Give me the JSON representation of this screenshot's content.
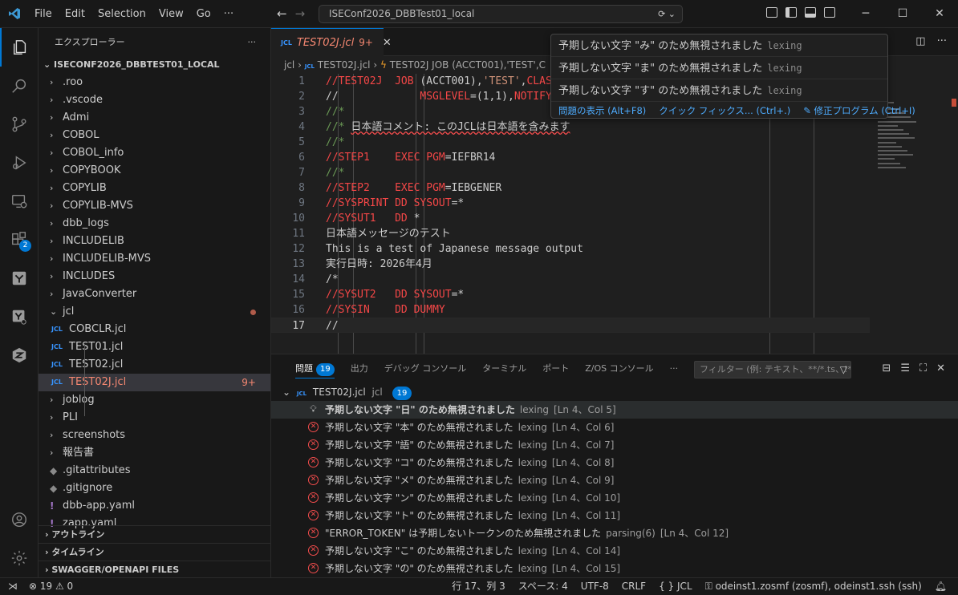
{
  "titlebar": {
    "menu": [
      "File",
      "Edit",
      "Selection",
      "View",
      "Go",
      "···"
    ],
    "search": "ISEConf2026_DBBTest01_local"
  },
  "activity": {
    "extensions_badge": "2"
  },
  "sidebar": {
    "title": "エクスプローラー",
    "more": "···",
    "root": "ISECONF2026_DBBTEST01_LOCAL",
    "items": [
      {
        "label": ".roo",
        "type": "folder"
      },
      {
        "label": ".vscode",
        "type": "folder"
      },
      {
        "label": "Admi",
        "type": "folder"
      },
      {
        "label": "COBOL",
        "type": "folder"
      },
      {
        "label": "COBOL_info",
        "type": "folder"
      },
      {
        "label": "COPYBOOK",
        "type": "folder"
      },
      {
        "label": "COPYLIB",
        "type": "folder"
      },
      {
        "label": "COPYLIB-MVS",
        "type": "folder"
      },
      {
        "label": "dbb_logs",
        "type": "folder"
      },
      {
        "label": "INCLUDELIB",
        "type": "folder"
      },
      {
        "label": "INCLUDELIB-MVS",
        "type": "folder"
      },
      {
        "label": "INCLUDES",
        "type": "folder"
      },
      {
        "label": "JavaConverter",
        "type": "folder"
      },
      {
        "label": "jcl",
        "type": "folder-open"
      },
      {
        "label": "COBCLR.jcl",
        "type": "jcl"
      },
      {
        "label": "TEST01.jcl",
        "type": "jcl"
      },
      {
        "label": "TEST02.jcl",
        "type": "jcl"
      },
      {
        "label": "TEST02J.jcl",
        "type": "jcl",
        "decoration": "9+"
      },
      {
        "label": "joblog",
        "type": "folder"
      },
      {
        "label": "PLI",
        "type": "folder"
      },
      {
        "label": "screenshots",
        "type": "folder"
      },
      {
        "label": "報告書",
        "type": "folder"
      },
      {
        "label": ".gitattributes",
        "type": "git"
      },
      {
        "label": ".gitignore",
        "type": "git"
      },
      {
        "label": "dbb-app.yaml",
        "type": "yaml"
      },
      {
        "label": "zapp.yaml",
        "type": "yaml"
      }
    ],
    "sections": [
      "アウトライン",
      "タイムライン",
      "SWAGGER/OPENAPI FILES"
    ]
  },
  "editor": {
    "tab": {
      "icon": "JCL",
      "name": "TEST02J.jcl",
      "count": "9+"
    },
    "breadcrumb": {
      "folder": "jcl",
      "file": "TEST02J.jcl",
      "symbol": "TEST02J  JOB (ACCT001),'TEST',C"
    },
    "lines": [
      {
        "n": "1",
        "t": "//TEST02J  JOB (ACCT001),'TEST',CLASS"
      },
      {
        "n": "2",
        "t": "//             MSGLEVEL=(1,1),NOTIFY"
      },
      {
        "n": "3",
        "t": "//*"
      },
      {
        "n": "4",
        "t": "//* 日本語コメント: このJCLは日本語を含みます"
      },
      {
        "n": "5",
        "t": "//*"
      },
      {
        "n": "6",
        "t": "//STEP1    EXEC PGM=IEFBR14"
      },
      {
        "n": "7",
        "t": "//*"
      },
      {
        "n": "8",
        "t": "//STEP2    EXEC PGM=IEBGENER"
      },
      {
        "n": "9",
        "t": "//SYSPRINT DD SYSOUT=*"
      },
      {
        "n": "10",
        "t": "//SYSUT1   DD *"
      },
      {
        "n": "11",
        "t": "日本語メッセージのテスト"
      },
      {
        "n": "12",
        "t": "This is a test of Japanese message output"
      },
      {
        "n": "13",
        "t": "実行日時: 2026年4月"
      },
      {
        "n": "14",
        "t": "/*"
      },
      {
        "n": "15",
        "t": "//SYSUT2   DD SYSOUT=*"
      },
      {
        "n": "16",
        "t": "//SYSIN    DD DUMMY"
      },
      {
        "n": "17",
        "t": "//"
      }
    ]
  },
  "hover": {
    "messages": [
      {
        "text": "予期しない文字 \"み\" のため無視されました",
        "source": "lexing"
      },
      {
        "text": "予期しない文字 \"ま\" のため無視されました",
        "source": "lexing"
      },
      {
        "text": "予期しない文字 \"す\" のため無視されました",
        "source": "lexing"
      }
    ],
    "actions": [
      "問題の表示 (Alt+F8)",
      "クイック フィックス... (Ctrl+.)",
      "修正プログラム (Ctrl+I)"
    ]
  },
  "panel": {
    "tabs": [
      {
        "label": "問題",
        "badge": "19"
      },
      {
        "label": "出力"
      },
      {
        "label": "デバッグ コンソール"
      },
      {
        "label": "ターミナル"
      },
      {
        "label": "ポート"
      },
      {
        "label": "Z/OS コンソール"
      },
      {
        "label": "···"
      }
    ],
    "filter_placeholder": "フィルター (例: テキスト、**/*.ts、!*...",
    "file": {
      "icon": "JCL",
      "name": "TEST02J.jcl",
      "dir": "jcl",
      "count": "19"
    },
    "problems": [
      {
        "msg": "予期しない文字 \"日\" のため無視されました",
        "src": "lexing",
        "loc": "[Ln 4、Col 5]",
        "kind": "bulb"
      },
      {
        "msg": "予期しない文字 \"本\" のため無視されました",
        "src": "lexing",
        "loc": "[Ln 4、Col 6]",
        "kind": "error"
      },
      {
        "msg": "予期しない文字 \"語\" のため無視されました",
        "src": "lexing",
        "loc": "[Ln 4、Col 7]",
        "kind": "error"
      },
      {
        "msg": "予期しない文字 \"コ\" のため無視されました",
        "src": "lexing",
        "loc": "[Ln 4、Col 8]",
        "kind": "error"
      },
      {
        "msg": "予期しない文字 \"メ\" のため無視されました",
        "src": "lexing",
        "loc": "[Ln 4、Col 9]",
        "kind": "error"
      },
      {
        "msg": "予期しない文字 \"ン\" のため無視されました",
        "src": "lexing",
        "loc": "[Ln 4、Col 10]",
        "kind": "error"
      },
      {
        "msg": "予期しない文字 \"ト\" のため無視されました",
        "src": "lexing",
        "loc": "[Ln 4、Col 11]",
        "kind": "error"
      },
      {
        "msg": "\"ERROR_TOKEN\" は予期しないトークンのため無視されました",
        "src": "parsing(6)",
        "loc": "[Ln 4、Col 12]",
        "kind": "error"
      },
      {
        "msg": "予期しない文字 \"こ\" のため無視されました",
        "src": "lexing",
        "loc": "[Ln 4、Col 14]",
        "kind": "error"
      },
      {
        "msg": "予期しない文字 \"の\" のため無視されました",
        "src": "lexing",
        "loc": "[Ln 4、Col 15]",
        "kind": "error"
      }
    ]
  },
  "statusbar": {
    "errors": "19",
    "warnings": "0",
    "position": "行 17、列 3",
    "spaces": "スペース: 4",
    "encoding": "UTF-8",
    "eol": "CRLF",
    "language": "JCL",
    "remote": "odeinst1.zosmf (zosmf), odeinst1.ssh (ssh)"
  }
}
